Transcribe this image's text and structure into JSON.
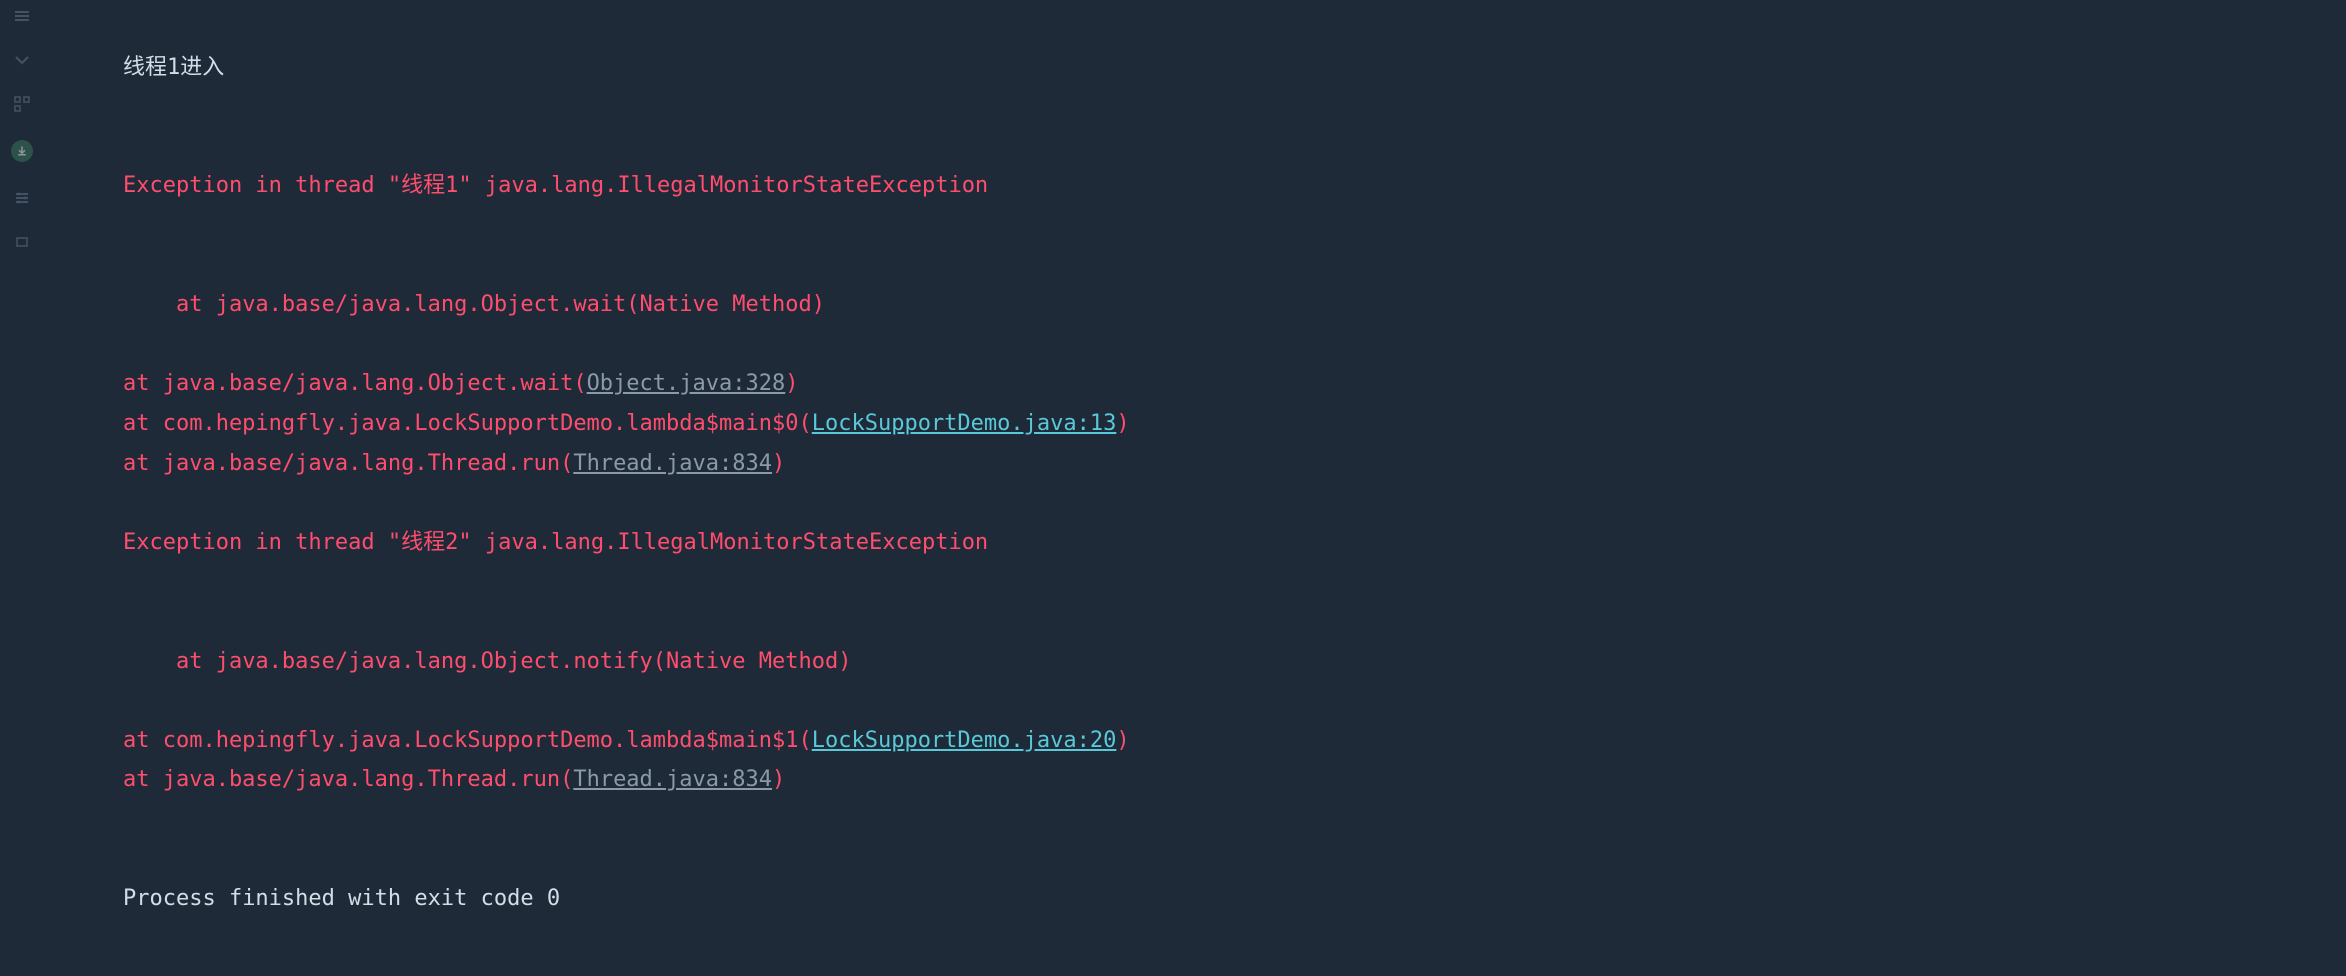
{
  "gutter": {
    "icons": [
      "menu",
      "caret",
      "structure",
      "download",
      "settings",
      "pin"
    ]
  },
  "console": {
    "line1": "线程1进入",
    "line2_a": "Exception in thread \"线程1\" java.lang.IllegalMonitorStateException",
    "line3_a": "    at java.base/java.lang.Object.wait(Native Method)",
    "line4_prefix": "    at java.base/java.lang.Object.wait(",
    "line4_link": "Object.java:328",
    "line4_suffix": ")",
    "line5_prefix": "    at com.hepingfly.java.LockSupportDemo.lambda$main$0(",
    "line5_link": "LockSupportDemo.java:13",
    "line5_suffix": ")",
    "line6_prefix": "    at java.base/java.lang.Thread.run(",
    "line6_link": "Thread.java:834",
    "line6_suffix": ")",
    "line7_a": "Exception in thread \"线程2\" java.lang.IllegalMonitorStateException",
    "line8_a": "    at java.base/java.lang.Object.notify(Native Method)",
    "line9_prefix": "    at com.hepingfly.java.LockSupportDemo.lambda$main$1(",
    "line9_link": "LockSupportDemo.java:20",
    "line9_suffix": ")",
    "line10_prefix": "    at java.base/java.lang.Thread.run(",
    "line10_link": "Thread.java:834",
    "line10_suffix": ")",
    "exit_line": "Process finished with exit code 0"
  }
}
